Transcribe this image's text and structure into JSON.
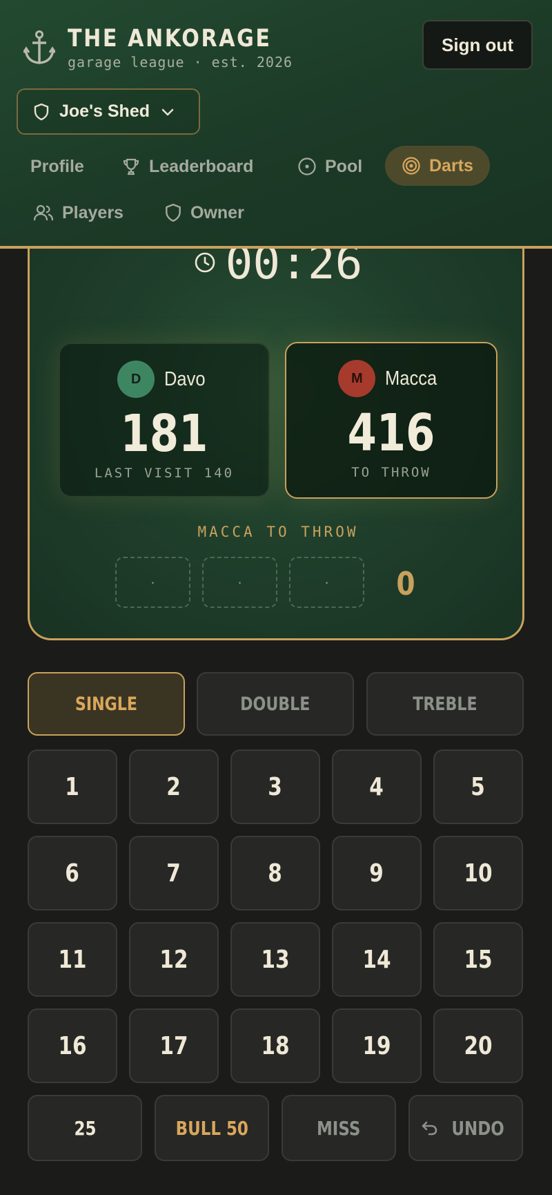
{
  "header": {
    "title": "THE ANKORAGE",
    "subtitle": "garage league · est. 2026",
    "sign_out": "Sign out",
    "venue": "Joe's Shed"
  },
  "nav": {
    "profile": "Profile",
    "leaderboard": "Leaderboard",
    "pool": "Pool",
    "darts": "Darts",
    "players": "Players",
    "owner": "Owner",
    "active": "Darts"
  },
  "game": {
    "timer": "00:26",
    "players": [
      {
        "initial": "D",
        "name": "Davo",
        "score": "181",
        "status": "LAST VISIT 140"
      },
      {
        "initial": "M",
        "name": "Macca",
        "score": "416",
        "status": "TO THROW"
      }
    ],
    "turn_label": "MACCA TO THROW",
    "darts": [
      "·",
      "·",
      "·"
    ],
    "visit_total": "0"
  },
  "keypad": {
    "multipliers": [
      "SINGLE",
      "DOUBLE",
      "TREBLE"
    ],
    "active_multiplier": "SINGLE",
    "numbers": [
      "1",
      "2",
      "3",
      "4",
      "5",
      "6",
      "7",
      "8",
      "9",
      "10",
      "11",
      "12",
      "13",
      "14",
      "15",
      "16",
      "17",
      "18",
      "19",
      "20"
    ],
    "bottom": {
      "outer_bull": "25",
      "bull": "BULL 50",
      "miss": "MISS",
      "undo": "UNDO"
    }
  },
  "colors": {
    "accent": "#c9a15c",
    "felt": "#1f3f2b",
    "background": "#1b1c1a"
  }
}
